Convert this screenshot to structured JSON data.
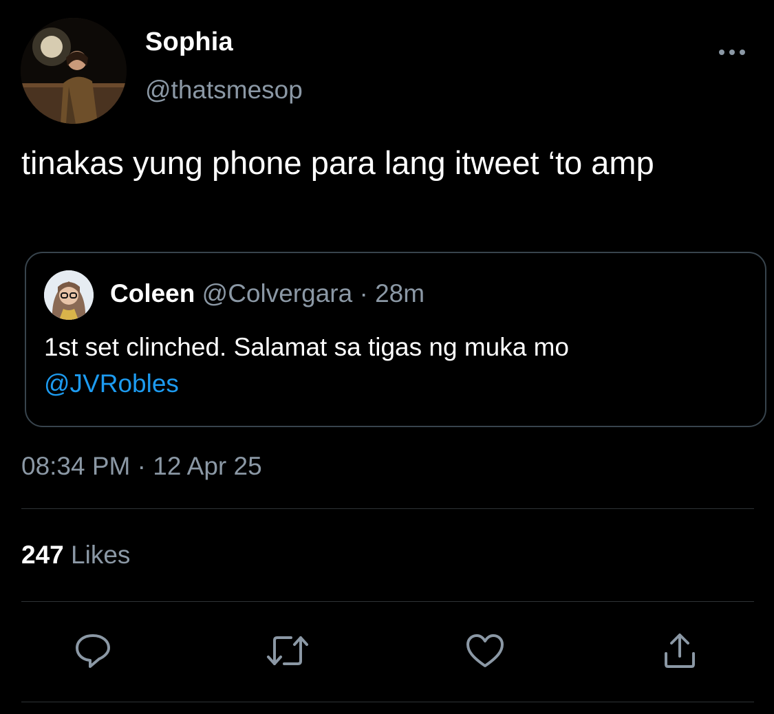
{
  "tweet": {
    "author_name": "Sophia",
    "author_handle": "@thatsmesop",
    "text": "tinakas yung phone para lang itweet ‘to amp",
    "timestamp": "08:34 PM · 12 Apr 25"
  },
  "quote": {
    "author_name": "Coleen",
    "author_handle": "@Colvergara",
    "separator": "·",
    "time": "28m",
    "text": "1st set clinched. Salamat sa tigas ng muka mo",
    "mention": "@JVRobles"
  },
  "stats": {
    "likes_count": "247",
    "likes_label": "Likes"
  },
  "actions": {
    "reply_icon": "reply-icon",
    "retweet_icon": "retweet-icon",
    "like_icon": "heart-icon",
    "share_icon": "share-icon"
  },
  "colors": {
    "background": "#000000",
    "text": "#ffffff",
    "secondary": "#8b98a5",
    "link": "#1d9bf0",
    "border": "#38444d"
  }
}
